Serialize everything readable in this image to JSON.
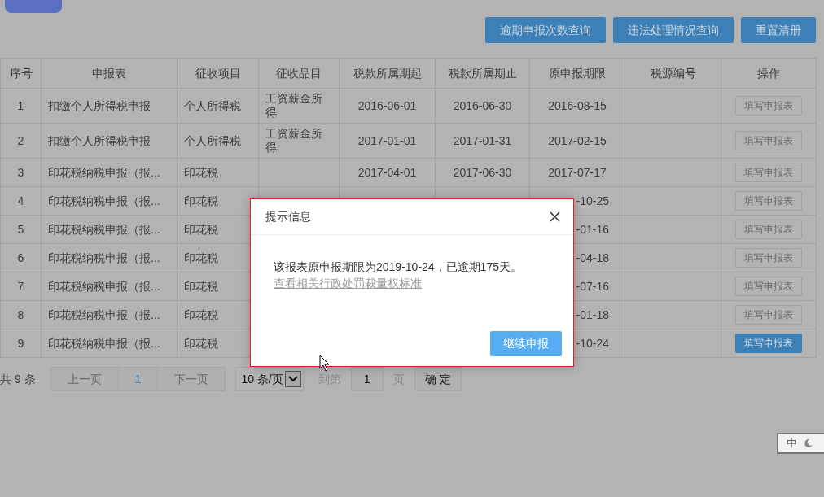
{
  "toolbar": {
    "buttons": [
      "逾期申报次数查询",
      "违法处理情况查询",
      "重置清册"
    ]
  },
  "table": {
    "columns": [
      "序号",
      "申报表",
      "征收项目",
      "征收品目",
      "税款所属期起",
      "税款所属期止",
      "原申报期限",
      "税源编号",
      "操作"
    ],
    "rows": [
      {
        "no": "1",
        "form": "扣缴个人所得税申报",
        "item": "个人所得税",
        "subitem": "工资薪金所得",
        "start": "2016-06-01",
        "end": "2016-06-30",
        "deadline": "2016-08-15",
        "action": {
          "label": "填写申报表",
          "disabled": true
        }
      },
      {
        "no": "2",
        "form": "扣缴个人所得税申报",
        "item": "个人所得税",
        "subitem": "工资薪金所得",
        "start": "2017-01-01",
        "end": "2017-01-31",
        "deadline": "2017-02-15",
        "action": {
          "label": "填写申报表",
          "disabled": true
        }
      },
      {
        "no": "3",
        "form": "印花税纳税申报（报...",
        "item": "印花税",
        "start": "2017-04-01",
        "end": "2017-06-30",
        "deadline": "2017-07-17",
        "action": {
          "label": "填写申报表",
          "disabled": true
        }
      },
      {
        "no": "4",
        "form": "印花税纳税申报（报...",
        "item": "印花税",
        "deadline": "-10-25",
        "action": {
          "label": "填写申报表",
          "disabled": true
        }
      },
      {
        "no": "5",
        "form": "印花税纳税申报（报...",
        "item": "印花税",
        "deadline": "-01-16",
        "action": {
          "label": "填写申报表",
          "disabled": true
        }
      },
      {
        "no": "6",
        "form": "印花税纳税申报（报...",
        "item": "印花税",
        "deadline": "-04-18",
        "action": {
          "label": "填写申报表",
          "disabled": true
        }
      },
      {
        "no": "7",
        "form": "印花税纳税申报（报...",
        "item": "印花税",
        "deadline": "-07-16",
        "action": {
          "label": "填写申报表",
          "disabled": true
        }
      },
      {
        "no": "8",
        "form": "印花税纳税申报（报...",
        "item": "印花税",
        "deadline": "-01-18",
        "action": {
          "label": "填写申报表",
          "disabled": true
        }
      },
      {
        "no": "9",
        "form": "印花税纳税申报（报...",
        "item": "印花税",
        "deadline": "-10-24",
        "action": {
          "label": "填写申报表",
          "disabled": false
        }
      }
    ]
  },
  "pagination": {
    "total": "共 9 条",
    "pages": [
      {
        "label": "上一页",
        "selected": false,
        "disabled": true
      },
      {
        "label": "1",
        "selected": true,
        "disabled": false
      },
      {
        "label": "下一页",
        "selected": false,
        "disabled": true
      }
    ],
    "page_size": "10 条/页",
    "goto_label": "到第",
    "goto_value": "1",
    "page_unit": "页",
    "confirm": "确 定"
  },
  "modal": {
    "title": "提示信息",
    "message": "该报表原申报期限为2019-10-24，已逾期175天。",
    "link": "查看相关行政处罚裁量权标准",
    "button": "继续申报"
  },
  "ime": {
    "label": "中"
  }
}
